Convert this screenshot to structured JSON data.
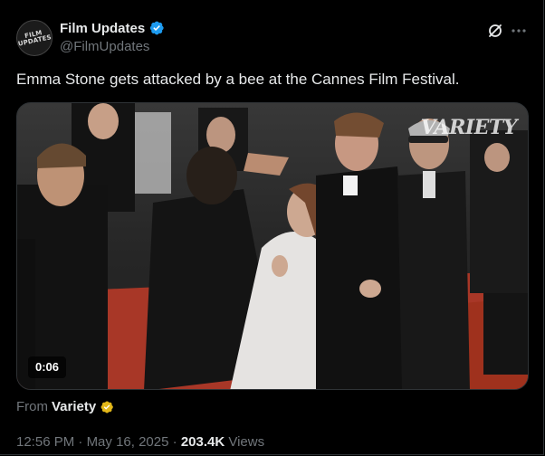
{
  "author": {
    "display_name": "Film Updates",
    "handle": "@FilmUpdates",
    "avatar_logo_line1": "FILM",
    "avatar_logo_line2": "UPDATES"
  },
  "tweet": {
    "text": "Emma Stone gets attacked by a bee at the Cannes Film Festival."
  },
  "media": {
    "type": "video",
    "duration": "0:06",
    "watermark": "VARIETY"
  },
  "source": {
    "prefix": "From",
    "name": "Variety"
  },
  "meta": {
    "time": "12:56 PM",
    "separator": "·",
    "date": "May 16, 2025",
    "views_count": "203.4K",
    "views_label": "Views"
  },
  "colors": {
    "background": "#000000",
    "text_primary": "#e7e9ea",
    "text_secondary": "#71767b",
    "verified_blue": "#1d9bf0",
    "verified_gold": "#e2b719"
  },
  "icons": {
    "verified": "verified-badge-icon",
    "grok": "grok-icon",
    "more": "more-options-icon",
    "org_badge": "gold-verified-badge-icon"
  }
}
